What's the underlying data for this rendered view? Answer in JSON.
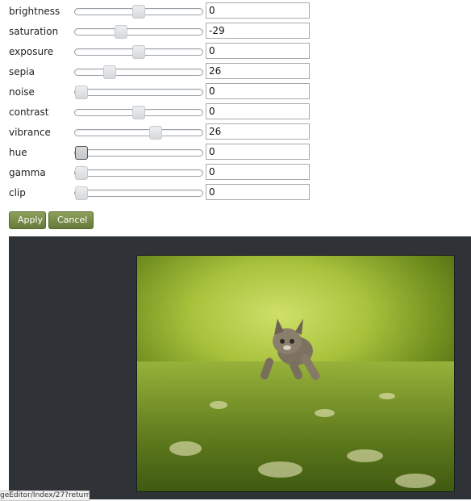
{
  "adjustments": [
    {
      "label": "brightness",
      "value": "0",
      "slider_position": 0.5
    },
    {
      "label": "saturation",
      "value": "-29",
      "slider_position": 0.36
    },
    {
      "label": "exposure",
      "value": "0",
      "slider_position": 0.5
    },
    {
      "label": "sepia",
      "value": "26",
      "slider_position": 0.27
    },
    {
      "label": "noise",
      "value": "0",
      "slider_position": 0.0
    },
    {
      "label": "contrast",
      "value": "0",
      "slider_position": 0.5
    },
    {
      "label": "vibrance",
      "value": "26",
      "slider_position": 0.63
    },
    {
      "label": "hue",
      "value": "0",
      "slider_position": 0.0
    },
    {
      "label": "gamma",
      "value": "0",
      "slider_position": 0.0
    },
    {
      "label": "clip",
      "value": "0",
      "slider_position": 0.0
    }
  ],
  "buttons": {
    "apply": "Apply",
    "cancel": "Cancel"
  },
  "status_bar": "geEditor/Index/27?return",
  "colors": {
    "button": "#7a8f45",
    "preview_bg": "#2f3337"
  }
}
